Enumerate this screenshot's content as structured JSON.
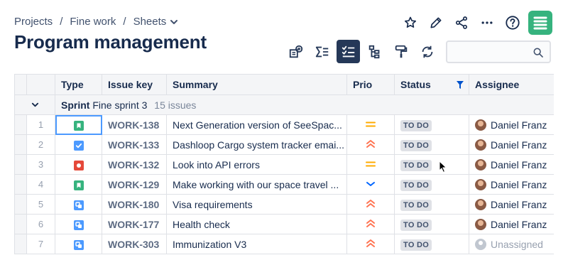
{
  "breadcrumb": {
    "items": [
      "Projects",
      "Fine work",
      "Sheets"
    ],
    "separator": "/"
  },
  "page": {
    "title": "Program management"
  },
  "top_actions": [
    "star-icon",
    "pencil-icon",
    "share-icon",
    "more-icon",
    "help-icon",
    "app-logo"
  ],
  "toolbar": {
    "buttons": [
      "insert-field-icon",
      "sum-icon",
      "checklist-icon",
      "hierarchy-icon",
      "paint-roller-icon",
      "refresh-icon"
    ],
    "active": "checklist-icon"
  },
  "search": {
    "value": "",
    "placeholder": ""
  },
  "columns": [
    "Type",
    "Issue key",
    "Summary",
    "Prio",
    "Status",
    "Assignee"
  ],
  "group": {
    "label": "Sprint",
    "name": "Fine sprint 3",
    "count": "15 issues"
  },
  "rows": [
    {
      "num": "1",
      "type": "story",
      "key": "WORK-138",
      "summary": "Next Generation version of SeeSpac...",
      "prio": "medium",
      "status": "TO DO",
      "assignee": "Daniel Franz"
    },
    {
      "num": "2",
      "type": "task",
      "key": "WORK-133",
      "summary": "Dashloop Cargo system tracker emai...",
      "prio": "high",
      "status": "TO DO",
      "assignee": "Daniel Franz"
    },
    {
      "num": "3",
      "type": "bug",
      "key": "WORK-132",
      "summary": "Look into API errors",
      "prio": "medium",
      "status": "TO DO",
      "assignee": "Daniel Franz"
    },
    {
      "num": "4",
      "type": "story",
      "key": "WORK-129",
      "summary": "Make working with our space travel ...",
      "prio": "low",
      "status": "TO DO",
      "assignee": "Daniel Franz"
    },
    {
      "num": "5",
      "type": "subtask",
      "key": "WORK-180",
      "summary": "Visa requirements",
      "prio": "high",
      "status": "TO DO",
      "assignee": "Daniel Franz"
    },
    {
      "num": "6",
      "type": "subtask",
      "key": "WORK-177",
      "summary": "Health check",
      "prio": "high",
      "status": "TO DO",
      "assignee": "Daniel Franz"
    },
    {
      "num": "7",
      "type": "subtask",
      "key": "WORK-303",
      "summary": "Immunization V3",
      "prio": "high",
      "status": "TO DO",
      "assignee": "Unassigned",
      "unassigned": true
    }
  ],
  "colors": {
    "story": "#36b37e",
    "task": "#4c9aff",
    "bug": "#e5493a",
    "subtask": "#4c9aff",
    "prio_medium": "#ffab00",
    "prio_high": "#ff7452",
    "prio_low": "#0065ff",
    "accent": "#4c9aff",
    "toolbar_active": "#253858"
  }
}
